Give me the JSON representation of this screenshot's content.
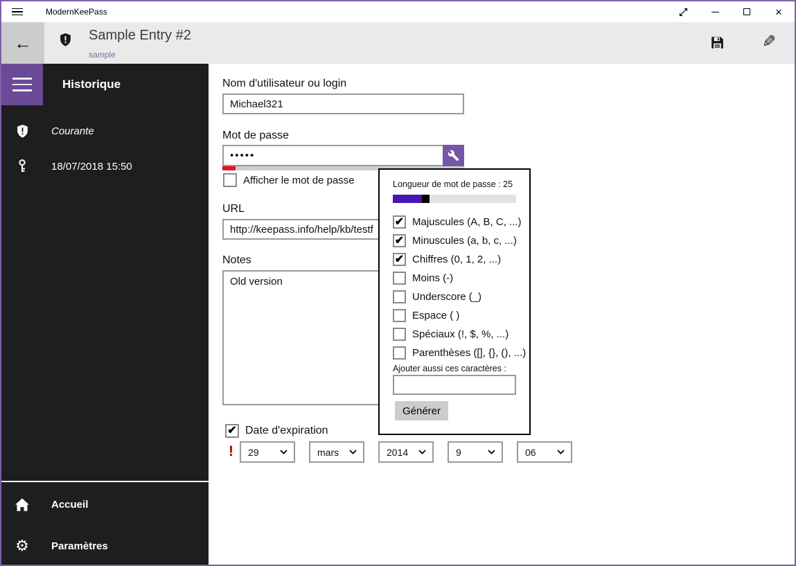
{
  "window": {
    "title": "ModernKeePass"
  },
  "header": {
    "entry_title": "Sample Entry #2",
    "entry_subtitle": "sample",
    "back_glyph": "←",
    "edit_glyph": "✎"
  },
  "sidebar": {
    "heading": "Historique",
    "items": [
      {
        "icon": "shield-exclamation-icon",
        "label": "Courante"
      },
      {
        "icon": "key-icon",
        "label": "18/07/2018 15:50"
      }
    ],
    "footer_items": [
      {
        "icon": "home-icon",
        "label": "Accueil"
      },
      {
        "icon": "gear-icon",
        "label": "Paramètres"
      }
    ],
    "gear_glyph": "⚙"
  },
  "form": {
    "username": {
      "label": "Nom d'utilisateur ou login",
      "value": "Michael321"
    },
    "password": {
      "label": "Mot de passe",
      "value": "•••••"
    },
    "show_password": {
      "label": "Afficher le mot de passe",
      "checked": false
    },
    "url": {
      "label": "URL",
      "value": "http://keepass.info/help/kb/testf"
    },
    "notes": {
      "label": "Notes",
      "value": "Old version"
    },
    "expiration": {
      "label": "Date d'expiration",
      "checked": true,
      "warning_glyph": "!",
      "day": "29",
      "month": "mars",
      "year": "2014",
      "hour": "9",
      "minute": "06"
    }
  },
  "generator": {
    "length_label": "Longueur de mot de passe : 25",
    "length_value": 25,
    "options": [
      {
        "label": "Majuscules (A, B, C, ...)",
        "checked": true
      },
      {
        "label": "Minuscules (a, b, c, ...)",
        "checked": true
      },
      {
        "label": "Chiffres (0, 1, 2, ...)",
        "checked": true
      },
      {
        "label": "Moins (-)",
        "checked": false
      },
      {
        "label": "Underscore (_)",
        "checked": false
      },
      {
        "label": "Espace ( )",
        "checked": false
      },
      {
        "label": "Spéciaux (!, $, %, ...)",
        "checked": false
      },
      {
        "label": "Parenthèses ([], {}, (), ...)",
        "checked": false
      }
    ],
    "custom_chars_label": "Ajouter aussi ces caractères :",
    "custom_chars_value": "",
    "custom_chars_placeholder": "",
    "generate_label": "Générer"
  },
  "colors": {
    "window_border": "#7e5fa8",
    "accent_purple": "#6b4a97",
    "wrench_button": "#7656a5",
    "slider_fill": "#4617b4",
    "strength_red": "#e81123",
    "link_purple": "#8160b3",
    "warning_red": "#b00000",
    "sidebar_bg": "#1e1e1e",
    "header_bg": "#eaeaea"
  }
}
